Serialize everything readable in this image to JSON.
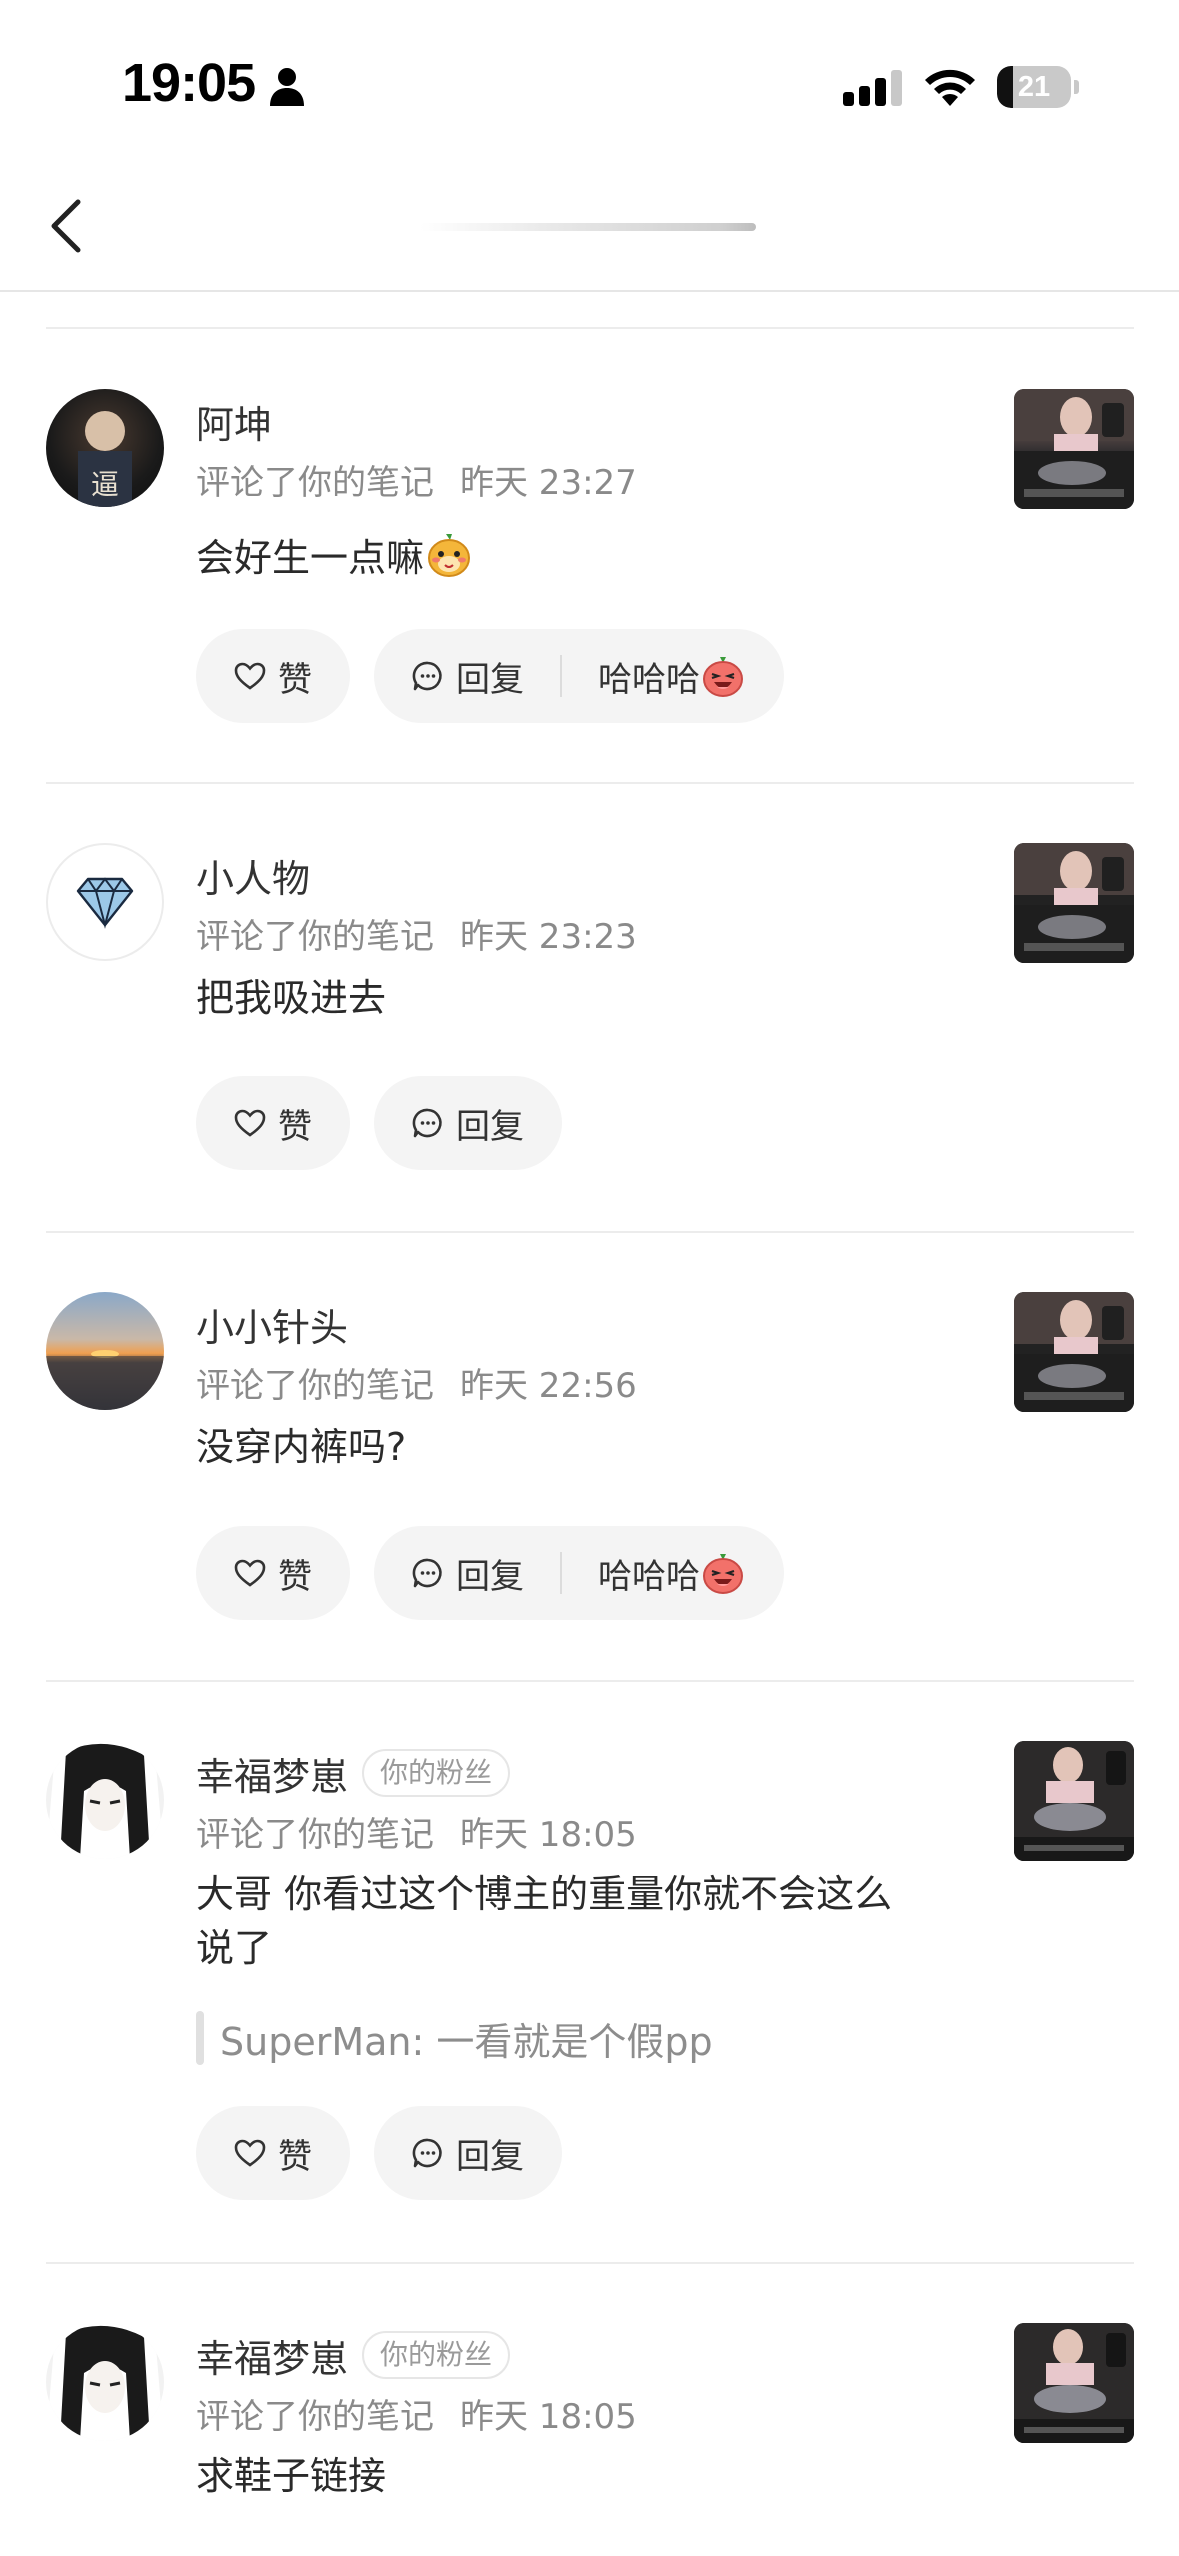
{
  "status_bar": {
    "time": "19:05",
    "battery": "21",
    "battery_level": 0.21
  },
  "nav": {
    "back_icon": "chevron-left-icon"
  },
  "items": [
    {
      "username": "阿坤",
      "badge": "",
      "action": "评论了你的笔记",
      "time": "昨天 23:27",
      "comment": "会好生一点嘛",
      "emoji": "cat-face-emoji",
      "quote": "",
      "like": "赞",
      "reply": "回复",
      "quick_reply": "哈哈哈",
      "quick_emoji": "laugh-emoji"
    },
    {
      "username": "小人物",
      "badge": "",
      "action": "评论了你的笔记",
      "time": "昨天 23:23",
      "comment": "把我吸进去",
      "emoji": "",
      "quote": "",
      "like": "赞",
      "reply": "回复",
      "quick_reply": "",
      "quick_emoji": ""
    },
    {
      "username": "小小针头",
      "badge": "",
      "action": "评论了你的笔记",
      "time": "昨天 22:56",
      "comment": "没穿内裤吗?",
      "emoji": "",
      "quote": "",
      "like": "赞",
      "reply": "回复",
      "quick_reply": "哈哈哈",
      "quick_emoji": "laugh-emoji"
    },
    {
      "username": "幸福梦崽",
      "badge": "你的粉丝",
      "action": "评论了你的笔记",
      "time": "昨天 18:05",
      "comment_line1": "大哥 你看过这个博主的重量你就不会这么",
      "comment_line2": "说了",
      "quote": "SuperMan: 一看就是个假pp",
      "like": "赞",
      "reply": "回复",
      "quick_reply": "",
      "quick_emoji": ""
    },
    {
      "username": "幸福梦崽",
      "badge": "你的粉丝",
      "action": "评论了你的笔记",
      "time": "昨天 18:05",
      "comment": "求鞋子链接",
      "emoji": "",
      "quote": "",
      "like": "",
      "reply": "",
      "quick_reply": "",
      "quick_emoji": ""
    }
  ]
}
